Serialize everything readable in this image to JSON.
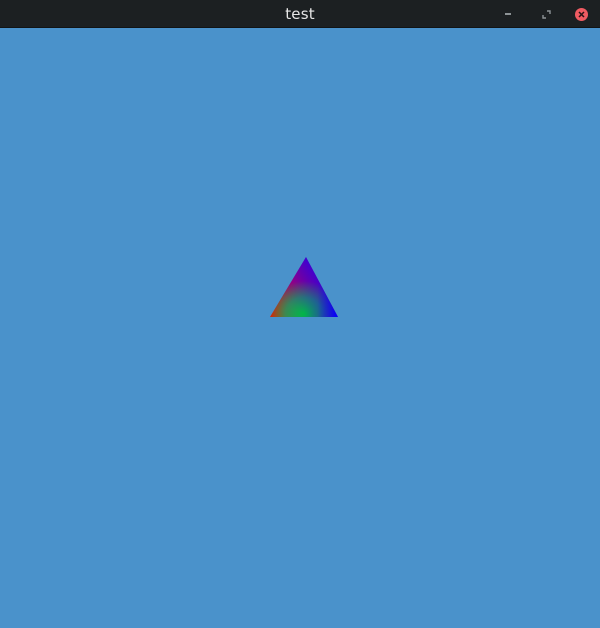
{
  "window": {
    "title": "test",
    "controls": {
      "minimize_icon": "minimize-icon",
      "maximize_icon": "maximize-icon",
      "close_icon": "close-icon"
    }
  },
  "viewport": {
    "clear_color": "#4a92cb",
    "shapes": [
      {
        "kind": "triangle",
        "vertex_colors": [
          "#0000ff",
          "#ff0000",
          "#00ff00",
          "#0000ff"
        ]
      },
      {
        "kind": "line",
        "vertex_colors": [
          "#ff0000",
          "#0000ff"
        ]
      }
    ]
  }
}
